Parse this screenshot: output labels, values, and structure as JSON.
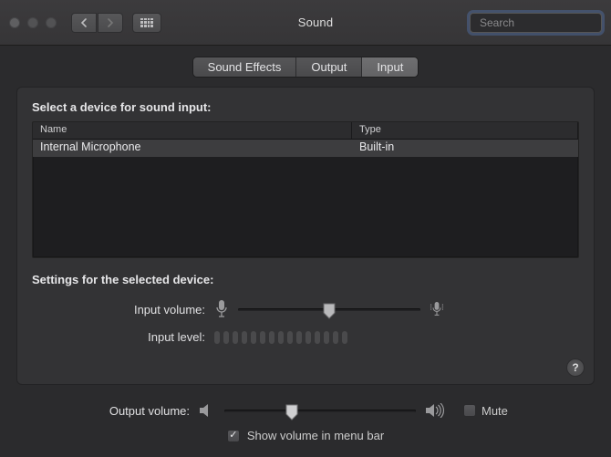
{
  "window": {
    "title": "Sound"
  },
  "search": {
    "placeholder": "Search",
    "value": ""
  },
  "tabs": {
    "effects": "Sound Effects",
    "output": "Output",
    "input": "Input",
    "active": "input"
  },
  "input_panel": {
    "select_label": "Select a device for sound input:",
    "columns": {
      "name": "Name",
      "type": "Type"
    },
    "rows": [
      {
        "name": "Internal Microphone",
        "type": "Built-in"
      }
    ],
    "settings_label": "Settings for the selected device:",
    "input_volume_label": "Input volume:",
    "input_volume_percent": 50,
    "input_level_label": "Input level:",
    "level_segments": 15
  },
  "footer": {
    "output_volume_label": "Output volume:",
    "output_volume_percent": 35,
    "mute_label": "Mute",
    "mute_checked": false,
    "show_in_menu_label": "Show volume in menu bar",
    "show_in_menu_checked": true
  },
  "help_glyph": "?"
}
